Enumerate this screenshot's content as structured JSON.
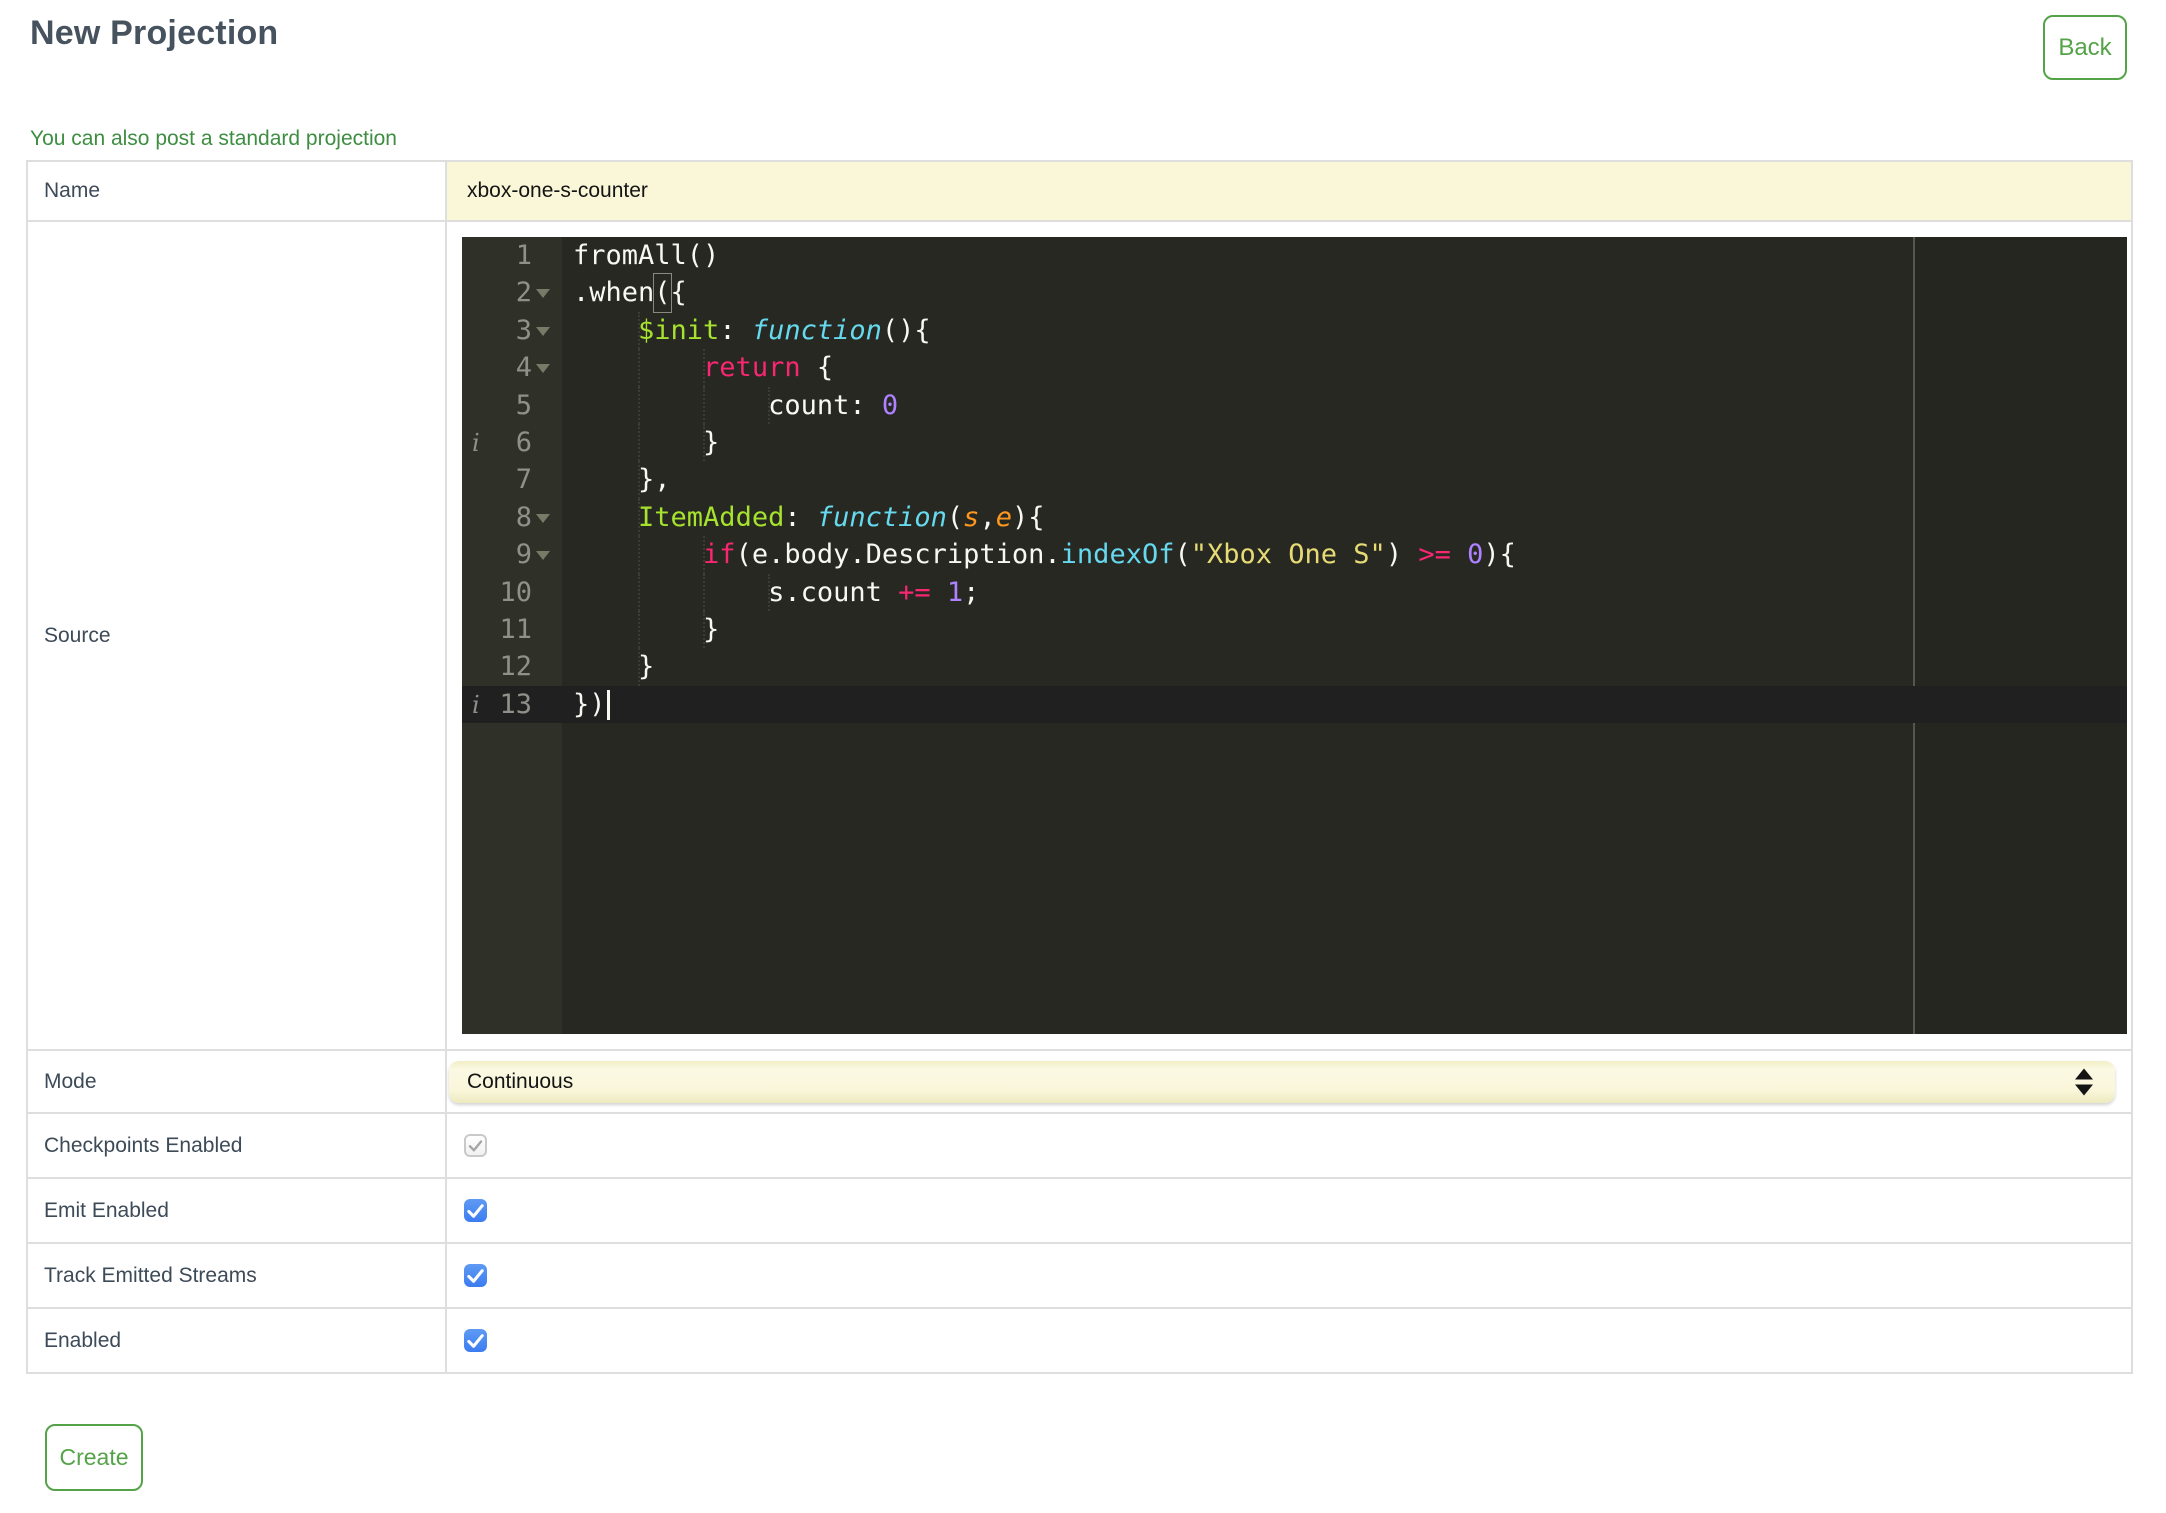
{
  "page": {
    "title": "New Projection",
    "back_button": "Back",
    "standard_projection_link": "You can also post a standard projection",
    "create_button": "Create"
  },
  "form": {
    "rows": [
      {
        "label": "Name",
        "type": "text-input",
        "value": "xbox-one-s-counter"
      },
      {
        "label": "Source",
        "type": "code-editor"
      },
      {
        "label": "Mode",
        "type": "select",
        "value": "Continuous"
      },
      {
        "label": "Checkpoints Enabled",
        "type": "checkbox",
        "checked": true,
        "disabled": true
      },
      {
        "label": "Emit Enabled",
        "type": "checkbox",
        "checked": true,
        "disabled": false
      },
      {
        "label": "Track Emitted Streams",
        "type": "checkbox",
        "checked": true,
        "disabled": false
      },
      {
        "label": "Enabled",
        "type": "checkbox",
        "checked": true,
        "disabled": false
      }
    ]
  },
  "source_editor": {
    "active_line": 13,
    "info_lines": [
      6,
      13
    ],
    "fold_lines": [
      2,
      3,
      4,
      8,
      9
    ],
    "lines": [
      {
        "n": 1,
        "tokens": [
          [
            "plain",
            "fromAll()"
          ]
        ]
      },
      {
        "n": 2,
        "fold": true,
        "tokens": [
          [
            "plain",
            ".when"
          ],
          [
            "bracket",
            "("
          ],
          [
            "plain",
            "{"
          ]
        ]
      },
      {
        "n": 3,
        "fold": true,
        "tokens": [
          [
            "plain",
            "    "
          ],
          [
            "entity",
            "$init"
          ],
          [
            "plain",
            ": "
          ],
          [
            "storage",
            "function"
          ],
          [
            "plain",
            "(){"
          ]
        ]
      },
      {
        "n": 4,
        "fold": true,
        "tokens": [
          [
            "plain",
            "        "
          ],
          [
            "keyword",
            "return"
          ],
          [
            "plain",
            " {"
          ]
        ]
      },
      {
        "n": 5,
        "tokens": [
          [
            "plain",
            "            count: "
          ],
          [
            "number",
            "0"
          ]
        ]
      },
      {
        "n": 6,
        "info": true,
        "tokens": [
          [
            "plain",
            "        }"
          ]
        ]
      },
      {
        "n": 7,
        "tokens": [
          [
            "plain",
            "    },"
          ]
        ]
      },
      {
        "n": 8,
        "fold": true,
        "tokens": [
          [
            "plain",
            "    "
          ],
          [
            "entity",
            "ItemAdded"
          ],
          [
            "plain",
            ": "
          ],
          [
            "storage",
            "function"
          ],
          [
            "plain",
            "("
          ],
          [
            "param",
            "s"
          ],
          [
            "plain",
            ","
          ],
          [
            "param",
            "e"
          ],
          [
            "plain",
            "){"
          ]
        ]
      },
      {
        "n": 9,
        "fold": true,
        "tokens": [
          [
            "plain",
            "        "
          ],
          [
            "keyword",
            "if"
          ],
          [
            "plain",
            "(e.body.Description."
          ],
          [
            "support",
            "indexOf"
          ],
          [
            "plain",
            "("
          ],
          [
            "string",
            "\"Xbox One S\""
          ],
          [
            "plain",
            ") "
          ],
          [
            "keyword",
            ">="
          ],
          [
            "plain",
            " "
          ],
          [
            "number",
            "0"
          ],
          [
            "plain",
            "){"
          ]
        ]
      },
      {
        "n": 10,
        "tokens": [
          [
            "plain",
            "            s.count "
          ],
          [
            "keyword",
            "+="
          ],
          [
            "plain",
            " "
          ],
          [
            "number",
            "1"
          ],
          [
            "plain",
            ";"
          ]
        ]
      },
      {
        "n": 11,
        "tokens": [
          [
            "plain",
            "        }"
          ]
        ]
      },
      {
        "n": 12,
        "tokens": [
          [
            "plain",
            "    }"
          ]
        ]
      },
      {
        "n": 13,
        "info": true,
        "active": true,
        "cursor": true,
        "tokens": [
          [
            "plain",
            "})"
          ]
        ]
      }
    ]
  },
  "colors": {
    "accent_green": "#55a348",
    "link_green": "#3e8e41",
    "heading_slate": "#47525f",
    "label_slate": "#3d4a57",
    "input_yellow": "#faf7d8",
    "checkbox_blue": "#4285f4",
    "editor_background": "#272822",
    "editor_gutter": "#2f3129",
    "editor_active_line": "#202020",
    "token_keyword": "#f92672",
    "token_entity": "#a6e22e",
    "token_storage": "#66d9ef",
    "token_string": "#e6db74",
    "token_number": "#ae81ff",
    "token_param": "#fd971f"
  }
}
